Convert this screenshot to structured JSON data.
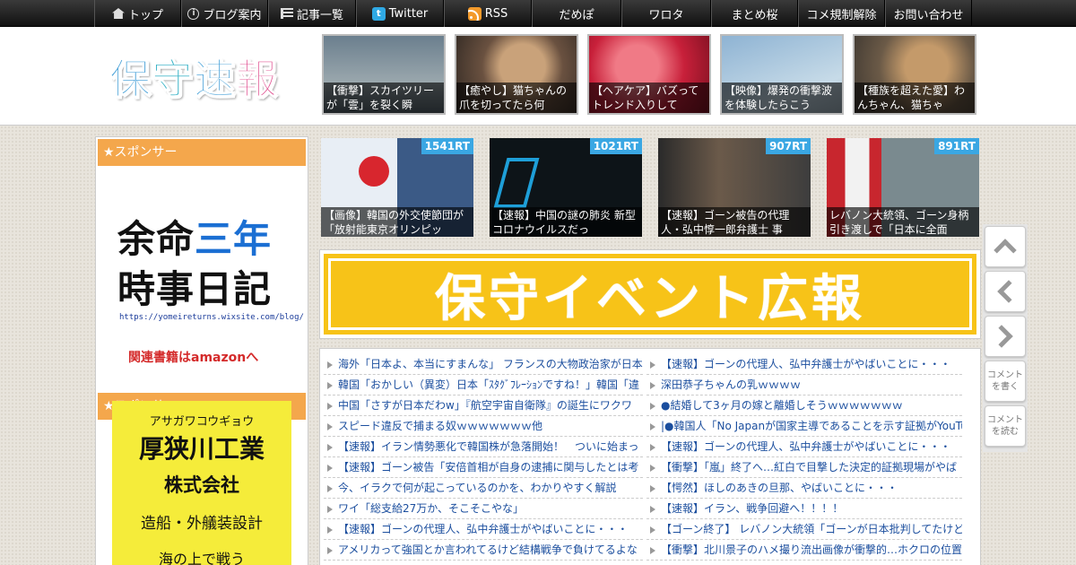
{
  "nav": {
    "items": [
      {
        "label": "トップ",
        "icon": "home-icon"
      },
      {
        "label": "ブログ案内",
        "icon": "info-icon"
      },
      {
        "label": "記事一覧",
        "icon": "list-icon"
      },
      {
        "label": "Twitter",
        "icon": "twitter-icon"
      },
      {
        "label": "RSS",
        "icon": "rss-icon"
      },
      {
        "label": "だめぽ"
      },
      {
        "label": "ワロタ"
      },
      {
        "label": "まとめ桜"
      },
      {
        "label": "コメ規制解除"
      },
      {
        "label": "お問い合わせ"
      }
    ],
    "twitter_glyph": "t"
  },
  "header": {
    "logo": {
      "c1": "保",
      "c2": "守",
      "c3": "速",
      "c4": "報"
    },
    "thumbs": [
      {
        "caption": "【衝撃】スカイツリーが「雲」を裂く瞬"
      },
      {
        "caption": "【癒やし】猫ちゃんの爪を切ってたら何"
      },
      {
        "caption": "【ヘアケア】バズってトレンド入りして"
      },
      {
        "caption": "【映像】爆発の衝撃波を体験したらこう"
      },
      {
        "caption": "【種族を超えた愛】わんちゃん、猫ちゃ"
      }
    ]
  },
  "sidebar": {
    "sponsor1_head": "★スポンサー",
    "ad1": {
      "l1a": "余命",
      "l1b": "三年",
      "l2": "時事日記",
      "url": "https://yomeireturns.wixsite.com/blog/",
      "amazon": "関連書籍はamazonへ"
    },
    "sponsor2_head": "★スポンサー",
    "ad2": {
      "kana": "アサガワコウギョウ",
      "name": "厚狭川工業",
      "kk": "株式会社",
      "business": "造船・外艤装設計",
      "more": "海の上で戦う"
    }
  },
  "rt_cards": [
    {
      "badge": "1541RT",
      "caption": "【画像】韓国の外交使節団が「放射能東京オリンピッ"
    },
    {
      "badge": "1021RT",
      "caption": "【速報】中国の謎の肺炎 新型コロナウイルスだっ"
    },
    {
      "badge": "907RT",
      "caption": "【速報】ゴーン被告の代理人・弘中惇一郎弁護士 事"
    },
    {
      "badge": "891RT",
      "caption": "レバノン大統領、ゴーン身柄引き渡しで「日本に全面"
    }
  ],
  "banner": {
    "text": "保守イベント広報"
  },
  "list_left": [
    "海外「日本よ、本当にすまんな」 フランスの大物政治家が日本",
    "韓国「おかしい（異変）日本「ｽﾀｸﾞﾌﾚｰｼｮﾝですね！」韓国「違",
    "中国「さすが日本だわw」『航空宇宙自衛隊』の誕生にワクワ",
    "スピード違反で捕まる奴ｗｗｗｗｗｗｗ他",
    "【速報】イラン情勢悪化で韓国株が急落開始！　ついに始まっ",
    "【速報】ゴーン被告「安倍首相が自身の逮捕に関与したとは考",
    "今、イラクで何が起こっているのかを、わかりやすく解説",
    "ワイ「総支給27万か、そこそこやな」",
    "【速報】ゴーンの代理人、弘中弁護士がやばいことに・・・",
    "アメリカって強国とか言われてるけど結構戦争で負けてるよな"
  ],
  "list_right": [
    "【速報】ゴーンの代理人、弘中弁護士がやばいことに・・・",
    "深田恭子ちゃんの乳ｗｗｗｗ",
    "●結婚して3ヶ月の嫁と離婚しそうｗｗｗｗｗｗｗ",
    "|●韓国人「No Japanが国家主導であることを示す証拠がYouTub",
    "【速報】ゴーンの代理人、弘中弁護士がやばいことに・・・",
    "【衝撃】「嵐」終了へ…紅白で目撃した決定的証拠現場がやば",
    "【愕然】ほしのあきの旦那、やばいことに・・・",
    "【速報】イラン、戦争回避へ！！！！",
    "【ゴーン終了】 レバノン大統領「ゴーンが日本批判してたけど",
    "【衝撃】北川景子のハメ撮り流出画像が衝撃的…ホクロの位置"
  ],
  "float": {
    "comment_write": "コメントを書く",
    "comment_read": "コメントを読む"
  },
  "colors": {
    "accent_orange": "#f4a74c",
    "rt_badge": "#3aa7e3",
    "banner_yellow": "#f7c318",
    "link_blue": "#1b4e9e"
  }
}
